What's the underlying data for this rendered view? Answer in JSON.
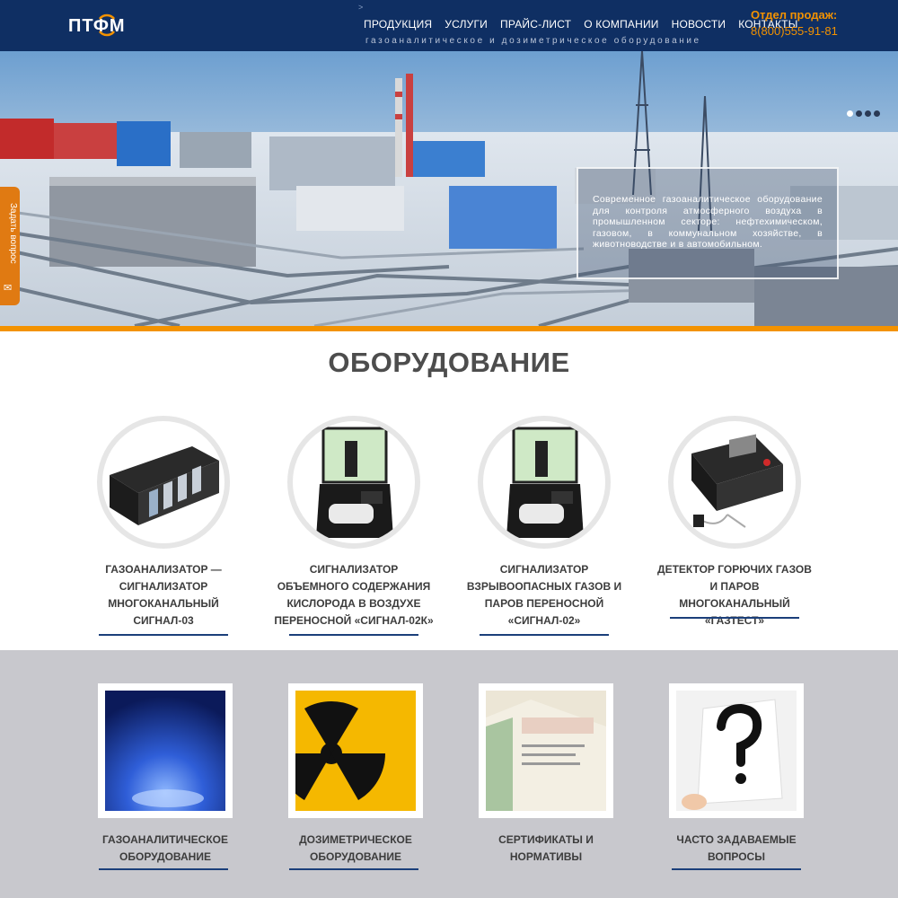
{
  "header": {
    "logo_text": "ПТФМ",
    "nav": [
      "ПРОДУКЦИЯ",
      "УСЛУГИ",
      "ПРАЙС-ЛИСТ",
      "О КОМПАНИИ",
      "НОВОСТИ",
      "КОНТАКТЫ"
    ],
    "tagline": "газоаналитическое и дозиметрическое оборудование",
    "sales_label": "Отдел продаж:",
    "sales_phone": "8(800)555-91-81"
  },
  "hero": {
    "caption": "Современное газоаналитическое оборудование для контроля атмосферного воздуха в промышленном секторе: нефтехимическом, газовом, в коммунальном хозяйстве, в животноводстве и в автомобильном.",
    "slides": 4,
    "active_slide": 1
  },
  "ask_tab": {
    "label": "Задать вопрос",
    "icon": "envelope-icon"
  },
  "equipment": {
    "title": "ОБОРУДОВАНИЕ",
    "products": [
      {
        "name": "ГАЗОАНАЛИЗАТОР — СИГНАЛИЗАТОР МНОГОКАНАЛЬНЫЙ СИГНАЛ-03"
      },
      {
        "name": "СИГНАЛИЗАТОР ОБЪЕМНОГО СОДЕРЖАНИЯ КИСЛОРОДА В ВОЗДУХЕ ПЕРЕНОСНОЙ «СИГНАЛ-02К»"
      },
      {
        "name": "СИГНАЛИЗАТОР ВЗРЫВООПАСНЫХ ГАЗОВ И ПАРОВ ПЕРЕНОСНОЙ «СИГНАЛ-02»"
      },
      {
        "name": "ДЕТЕКТОР ГОРЮЧИХ ГАЗОВ И ПАРОВ МНОГОКАНАЛЬНЫЙ «ГАЗТЕСТ»"
      }
    ]
  },
  "categories": [
    {
      "name": "ГАЗОАНАЛИТИЧЕСКОЕ ОБОРУДОВАНИЕ"
    },
    {
      "name": "ДОЗИМЕТРИЧЕСКОЕ ОБОРУДОВАНИЕ"
    },
    {
      "name": "СЕРТИФИКАТЫ И НОРМАТИВЫ"
    },
    {
      "name": "ЧАСТО ЗАДАВАЕМЫЕ ВОПРОСЫ"
    }
  ],
  "colors": {
    "header_bg": "#0f2f63",
    "accent": "#f39200",
    "underline": "#1b3f7a",
    "gray_section": "#c8c8cd"
  }
}
